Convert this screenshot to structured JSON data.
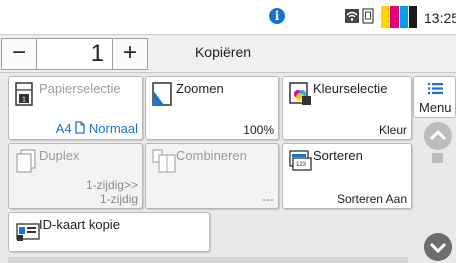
{
  "status": {
    "time": "13:25",
    "icons": [
      "info-icon",
      "wifi-icon",
      "sim-icon",
      "toner-level-icon"
    ],
    "toner_colors": [
      "#ffd400",
      "#e6007e",
      "#00a0e9",
      "#1a1a1a"
    ]
  },
  "qty": {
    "minus": "−",
    "value": "1",
    "plus": "+"
  },
  "mode_title": "Kopiëren",
  "menu": {
    "label": "Menu"
  },
  "tiles": {
    "papier": {
      "name": "Papierselectie",
      "value": "A4",
      "value2": "Normaal"
    },
    "zoom": {
      "name": "Zoomen",
      "value": "100%"
    },
    "kleur": {
      "name": "Kleurselectie",
      "value": "Kleur"
    },
    "duplex": {
      "name": "Duplex",
      "value_line1": "1-zijdig>>",
      "value_line2": "1-zijdig"
    },
    "comb": {
      "name": "Combineren",
      "value": "---"
    },
    "sort": {
      "name": "Sorteren",
      "value": "Sorteren Aan"
    },
    "idcard": {
      "name": "ID-kaart kopie"
    }
  },
  "accent_color": "#1a73d0"
}
